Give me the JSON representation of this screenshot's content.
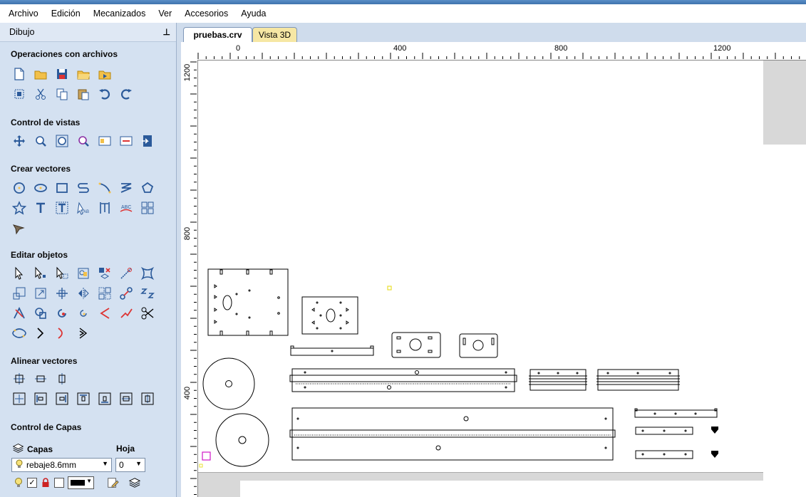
{
  "menu": [
    "Archivo",
    "Edición",
    "Mecanizados",
    "Ver",
    "Accesorios",
    "Ayuda"
  ],
  "panel": {
    "title": "Dibujo",
    "sections": {
      "files": "Operaciones con archivos",
      "views": "Control de vistas",
      "vectors": "Crear vectores",
      "edit": "Editar objetos",
      "align": "Alinear vectores",
      "layers": "Control de Capas"
    },
    "layers": {
      "capas_label": "Capas",
      "hoja_label": "Hoja",
      "layer_value": "rebaje8.6mm",
      "sheet_value": "0"
    }
  },
  "tabs": [
    {
      "label": "pruebas.crv",
      "active": true
    },
    {
      "label": "Vista 3D",
      "active": false
    }
  ],
  "ruler": {
    "h_labels": [
      "0",
      "400",
      "800",
      "1200"
    ],
    "v_labels": [
      "1200",
      "800",
      "400"
    ]
  },
  "colors": {
    "panel_bg": "#d4e1f1",
    "icon_blue": "#2b5a9a",
    "folder_yellow": "#f2c04a",
    "tab_yellow": "#f6e7a4"
  }
}
